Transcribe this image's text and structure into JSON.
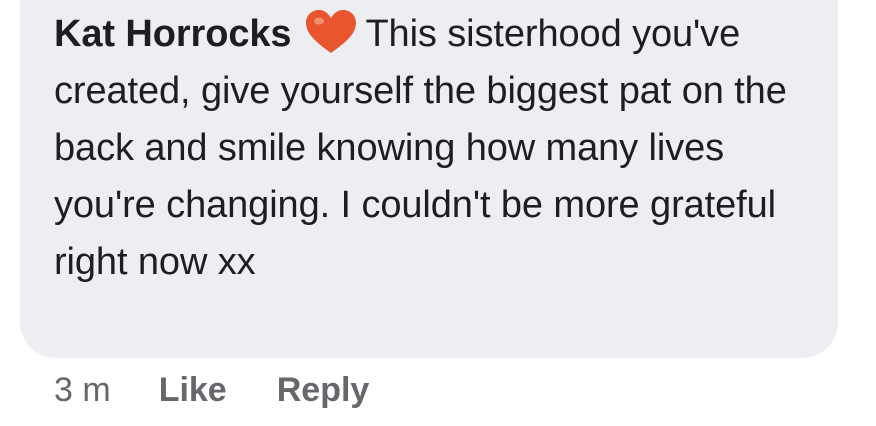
{
  "comment": {
    "author": "Kat Horrocks",
    "reaction_icon": "heart-emoji-icon",
    "text": "This sisterhood you've created, give yourself the biggest pat on the back and smile knowing how many lives you're changing. I couldn't be more grateful right now xx"
  },
  "actions": {
    "timestamp": "3 m",
    "like_label": "Like",
    "reply_label": "Reply"
  },
  "colors": {
    "bubble_background": "#edeef1",
    "text": "#1c1e21",
    "secondary_text": "#65676b",
    "heart": "#e8552f"
  }
}
